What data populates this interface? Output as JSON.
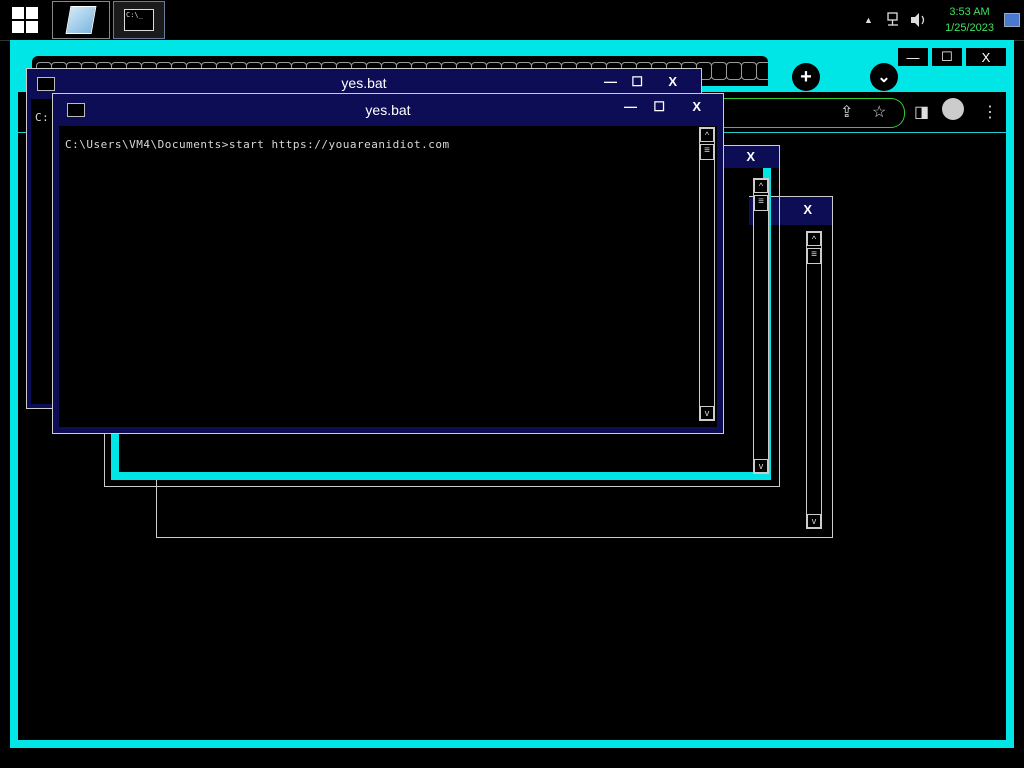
{
  "taskbar": {
    "start_icon": "windows-logo-icon",
    "apps": [
      {
        "name": "notepad",
        "icon": "notepad-icon"
      },
      {
        "name": "command-prompt",
        "icon": "cmd-icon",
        "icon_text": "C:\\_"
      }
    ],
    "tray": {
      "arrow": "▲",
      "time": "3:53 AM",
      "date": "1/25/2023"
    }
  },
  "browser": {
    "new_tab": "+",
    "tab_search": "⌄",
    "minimize": "—",
    "maximize": "☐",
    "close": "X"
  },
  "windows": {
    "main": {
      "title": "yes.bat",
      "minimize": "—",
      "maximize": "☐",
      "close": "X",
      "command": "C:\\Users\\VM4\\Documents>start https://youareanidiot.com"
    },
    "back": {
      "title": "yes.bat",
      "minimize": "—",
      "maximize": "☐",
      "close": "X",
      "prompt_fragment": "C:"
    },
    "lower1": {
      "close": "X"
    },
    "lower2": {
      "close": "X"
    }
  },
  "colors": {
    "accent_cyan": "#00e6e6",
    "title_navy": "#0d0d55",
    "clock_green": "#3ee060"
  }
}
